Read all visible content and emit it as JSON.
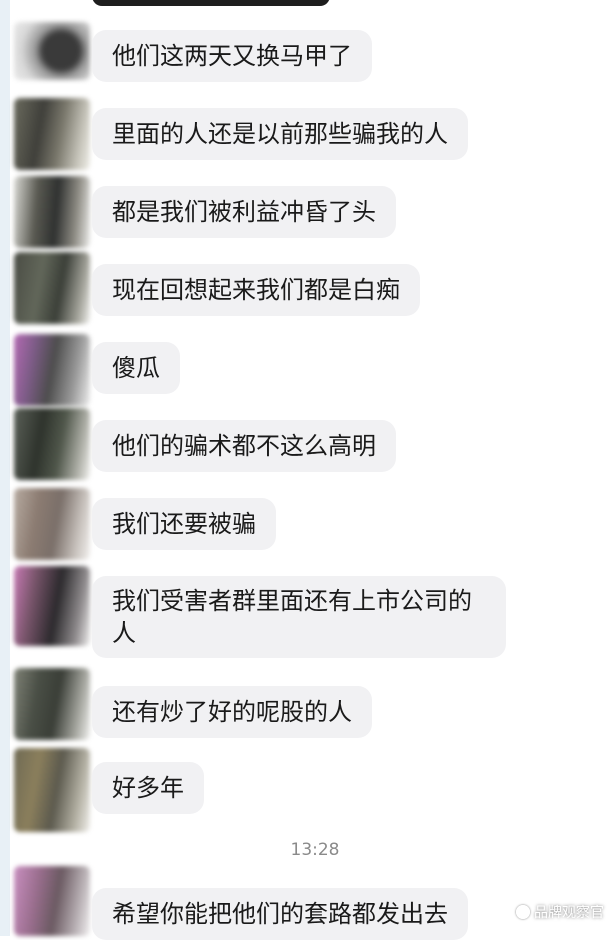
{
  "messages": [
    {
      "text": "他们这两天又换马甲了"
    },
    {
      "text": "里面的人还是以前那些骗我的人"
    },
    {
      "text": "都是我们被利益冲昏了头"
    },
    {
      "text": "现在回想起来我们都是白痴"
    },
    {
      "text": "傻瓜"
    },
    {
      "text": "他们的骗术都不这么高明"
    },
    {
      "text": "我们还要被骗"
    },
    {
      "text": "我们受害者群里面还有上市公司的\n人"
    },
    {
      "text": "还有炒了好的呢股的人"
    },
    {
      "text": "好多年"
    },
    {
      "text": "希望你能把他们的套路都发出去"
    }
  ],
  "timestamp": "13:28",
  "watermark": "品牌观察官",
  "colors": {
    "bubble_bg": "#f1f1f3",
    "text": "#1a1a1a",
    "timestamp": "#8a8a8a"
  }
}
